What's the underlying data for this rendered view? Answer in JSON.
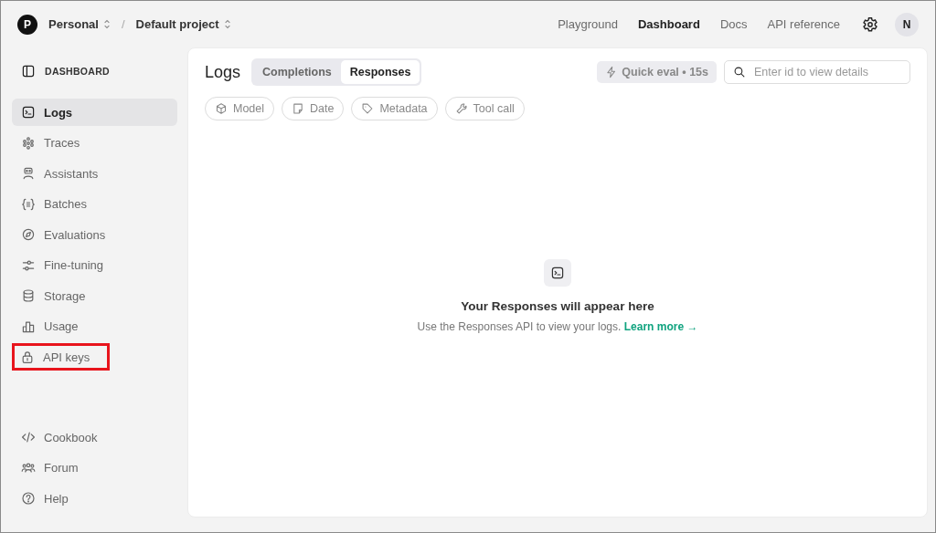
{
  "header": {
    "org": {
      "initial": "P",
      "name": "Personal"
    },
    "separator": "/",
    "project": "Default project",
    "nav": [
      {
        "label": "Playground",
        "selected": false
      },
      {
        "label": "Dashboard",
        "selected": true
      },
      {
        "label": "Docs",
        "selected": false
      },
      {
        "label": "API reference",
        "selected": false
      }
    ],
    "avatar": "N"
  },
  "sidebar": {
    "title": "DASHBOARD",
    "items": [
      {
        "label": "Logs",
        "selected": true,
        "highlighted": false
      },
      {
        "label": "Traces",
        "selected": false,
        "highlighted": false
      },
      {
        "label": "Assistants",
        "selected": false,
        "highlighted": false
      },
      {
        "label": "Batches",
        "selected": false,
        "highlighted": false
      },
      {
        "label": "Evaluations",
        "selected": false,
        "highlighted": false
      },
      {
        "label": "Fine-tuning",
        "selected": false,
        "highlighted": false
      },
      {
        "label": "Storage",
        "selected": false,
        "highlighted": false
      },
      {
        "label": "Usage",
        "selected": false,
        "highlighted": false
      },
      {
        "label": "API keys",
        "selected": false,
        "highlighted": true
      }
    ],
    "footer_items": [
      {
        "label": "Cookbook"
      },
      {
        "label": "Forum"
      },
      {
        "label": "Help"
      }
    ]
  },
  "main": {
    "title": "Logs",
    "tabs": [
      {
        "label": "Completions",
        "selected": false
      },
      {
        "label": "Responses",
        "selected": true
      }
    ],
    "quick_eval": "Quick eval • 15s",
    "search": {
      "placeholder": "Enter id to view details"
    },
    "filters": [
      {
        "label": "Model"
      },
      {
        "label": "Date"
      },
      {
        "label": "Metadata"
      },
      {
        "label": "Tool call"
      }
    ],
    "empty_state": {
      "heading": "Your Responses will appear here",
      "text": "Use the Responses API to view your logs.",
      "link": "Learn more →"
    }
  }
}
